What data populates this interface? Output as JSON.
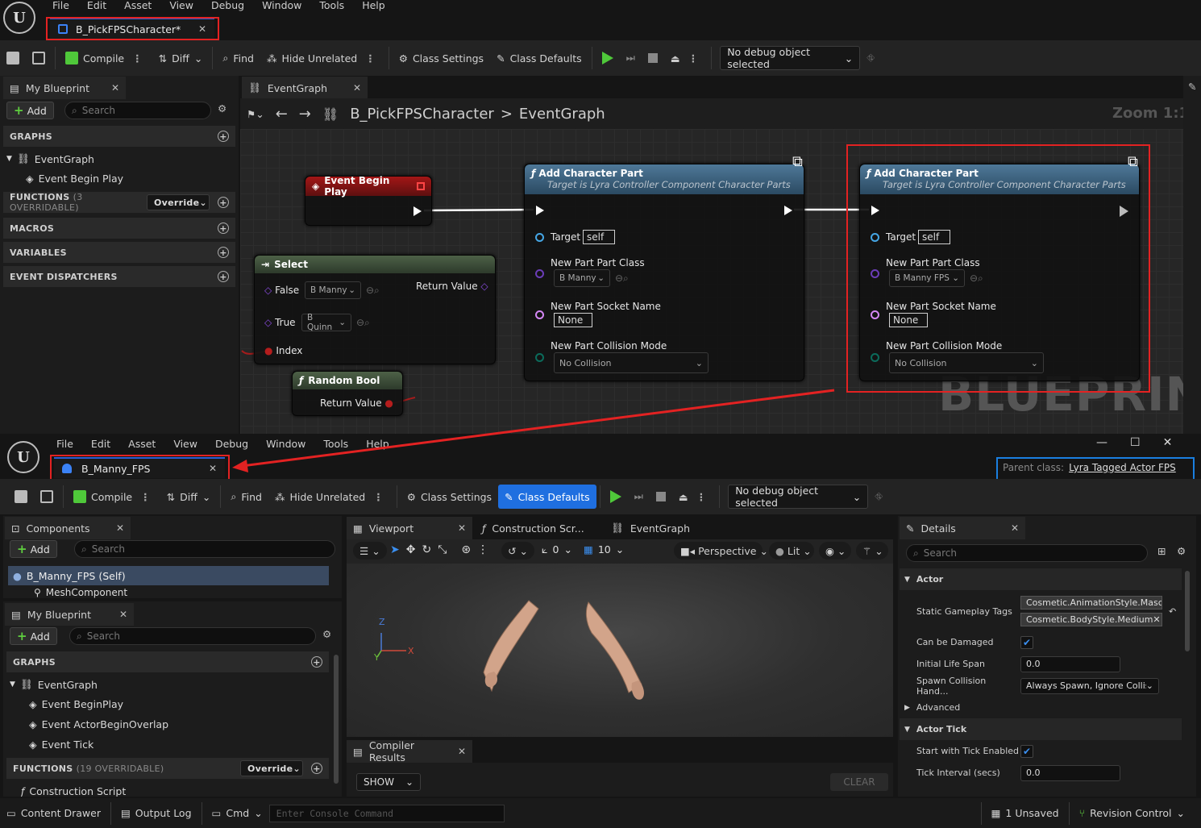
{
  "top": {
    "menu": [
      "File",
      "Edit",
      "Asset",
      "View",
      "Debug",
      "Window",
      "Tools",
      "Help"
    ],
    "doc_tab": "B_PickFPSCharacter*",
    "toolbar": {
      "compile": "Compile",
      "diff": "Diff",
      "find": "Find",
      "hide_unrelated": "Hide Unrelated",
      "class_settings": "Class Settings",
      "class_defaults": "Class Defaults",
      "debug_select": "No debug object selected"
    },
    "my_blueprint": {
      "tab": "My Blueprint",
      "add": "Add",
      "search_placeholder": "Search",
      "graphs": "GRAPHS",
      "event_graph": "EventGraph",
      "event_begin_play": "Event Begin Play",
      "functions": "FUNCTIONS",
      "functions_count": "(3 OVERRIDABLE)",
      "override": "Override",
      "macros": "MACROS",
      "variables": "VARIABLES",
      "event_dispatchers": "EVENT DISPATCHERS"
    },
    "graph": {
      "tab": "EventGraph",
      "breadcrumb_root": "B_PickFPSCharacter",
      "breadcrumb_sep": ">",
      "breadcrumb_leaf": "EventGraph",
      "zoom": "Zoom 1:1",
      "watermark": "BLUEPRINT",
      "event_node": "Event Begin Play",
      "select_node": {
        "title": "Select",
        "false_label": "False",
        "false_value": "B Manny",
        "true_label": "True",
        "true_value": "B Quinn",
        "index": "Index",
        "return": "Return Value"
      },
      "random_bool": {
        "title": "Random Bool",
        "return": "Return Value"
      },
      "add_part_1": {
        "title": "Add Character Part",
        "subtitle": "Target is Lyra Controller Component Character Parts",
        "target": "Target",
        "target_value": "self",
        "class_label": "New Part Part Class",
        "class_value": "B Manny",
        "socket_label": "New Part Socket Name",
        "socket_value": "None",
        "collision_label": "New Part Collision Mode",
        "collision_value": "No Collision"
      },
      "add_part_2": {
        "title": "Add Character Part",
        "subtitle": "Target is Lyra Controller Component Character Parts",
        "target": "Target",
        "target_value": "self",
        "class_label": "New Part Part Class",
        "class_value": "B Manny FPS",
        "socket_label": "New Part Socket Name",
        "socket_value": "None",
        "collision_label": "New Part Collision Mode",
        "collision_value": "No Collision"
      }
    }
  },
  "bottom": {
    "menu": [
      "File",
      "Edit",
      "Asset",
      "View",
      "Debug",
      "Window",
      "Tools",
      "Help"
    ],
    "doc_tab": "B_Manny_FPS",
    "parent_label": "Parent class:",
    "parent_value": "Lyra Tagged Actor FPS",
    "window_controls": {
      "minimize": "—",
      "maximize": "☐",
      "close": "✕"
    },
    "toolbar": {
      "compile": "Compile",
      "diff": "Diff",
      "find": "Find",
      "hide_unrelated": "Hide Unrelated",
      "class_settings": "Class Settings",
      "class_defaults": "Class Defaults",
      "debug_select": "No debug object selected"
    },
    "components": {
      "tab": "Components",
      "add": "Add",
      "search_placeholder": "Search",
      "self_item": "B_Manny_FPS (Self)",
      "mesh_item": "MeshComponent"
    },
    "my_blueprint": {
      "tab": "My Blueprint",
      "add": "Add",
      "search_placeholder": "Search",
      "graphs": "GRAPHS",
      "event_graph": "EventGraph",
      "events": [
        "Event BeginPlay",
        "Event ActorBeginOverlap",
        "Event Tick"
      ],
      "functions": "FUNCTIONS",
      "functions_count": "(19 OVERRIDABLE)",
      "override": "Override",
      "construction": "Construction Script"
    },
    "tabs": {
      "viewport": "Viewport",
      "construction": "Construction Scr...",
      "event_graph": "EventGraph"
    },
    "viewport": {
      "snap_angle": "0",
      "grid": "10",
      "perspective": "Perspective",
      "lit": "Lit",
      "axis_z": "Z",
      "axis_x": "X",
      "axis_y": "Y"
    },
    "compiler": {
      "tab": "Compiler Results",
      "show": "SHOW",
      "clear": "CLEAR"
    },
    "details": {
      "tab": "Details",
      "search_placeholder": "Search",
      "actor_section": "Actor",
      "static_tags_label": "Static Gameplay Tags",
      "tags": [
        "Cosmetic.AnimationStyle.Mascu",
        "Cosmetic.BodyStyle.Medium"
      ],
      "can_be_damaged": "Can be Damaged",
      "initial_life_span": "Initial Life Span",
      "initial_life_span_value": "0.0",
      "spawn_collision": "Spawn Collision Hand...",
      "spawn_collision_value": "Always Spawn, Ignore Collis",
      "advanced": "Advanced",
      "actor_tick": "Actor Tick",
      "start_tick": "Start with Tick Enabled",
      "tick_interval": "Tick Interval (secs)",
      "tick_interval_value": "0.0"
    },
    "status": {
      "content_drawer": "Content Drawer",
      "output_log": "Output Log",
      "cmd": "Cmd",
      "console_placeholder": "Enter Console Command",
      "unsaved": "1 Unsaved",
      "revision": "Revision Control"
    }
  },
  "colors": {
    "highlight_red": "#e32222",
    "highlight_blue": "#1a7fe0",
    "accent": "#2b78e4",
    "exec_green": "#4fc83a"
  }
}
